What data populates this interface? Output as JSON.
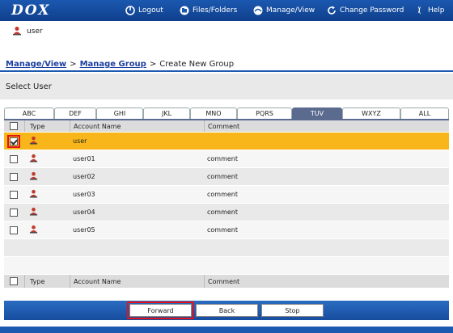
{
  "header": {
    "logo": "DOX",
    "nav": [
      {
        "label": "Logout",
        "icon": "logout-icon"
      },
      {
        "label": "Files/Folders",
        "icon": "files-folders-icon"
      },
      {
        "label": "Manage/View",
        "icon": "manage-view-icon"
      },
      {
        "label": "Change Password",
        "icon": "change-password-icon"
      },
      {
        "label": "Help",
        "icon": "help-icon"
      }
    ]
  },
  "user": {
    "name": "user",
    "icon": "user-icon"
  },
  "breadcrumb": {
    "items": [
      "Manage/View",
      "Manage Group",
      "Create New Group"
    ],
    "separator": ">"
  },
  "section": {
    "title": "Select User"
  },
  "tabs": [
    "ABC",
    "DEF",
    "GHI",
    "JKL",
    "MNO",
    "PQRS",
    "TUV",
    "WXYZ",
    "ALL"
  ],
  "active_tab": "TUV",
  "table": {
    "columns": [
      "Type",
      "Account Name",
      "Comment"
    ],
    "rows": [
      {
        "account": "user",
        "comment": "",
        "checked": true,
        "selected": true
      },
      {
        "account": "user01",
        "comment": "comment",
        "checked": false
      },
      {
        "account": "user02",
        "comment": "comment",
        "checked": false
      },
      {
        "account": "user03",
        "comment": "comment",
        "checked": false
      },
      {
        "account": "user04",
        "comment": "comment",
        "checked": false
      },
      {
        "account": "user05",
        "comment": "comment",
        "checked": false
      }
    ]
  },
  "actions": {
    "forward": "Forward",
    "back": "Back",
    "stop": "Stop"
  },
  "colors": {
    "brand": "#1b58b0",
    "selected_row": "#f9b61b",
    "active_tab": "#5b6b8f",
    "highlight": "#e0141c"
  }
}
